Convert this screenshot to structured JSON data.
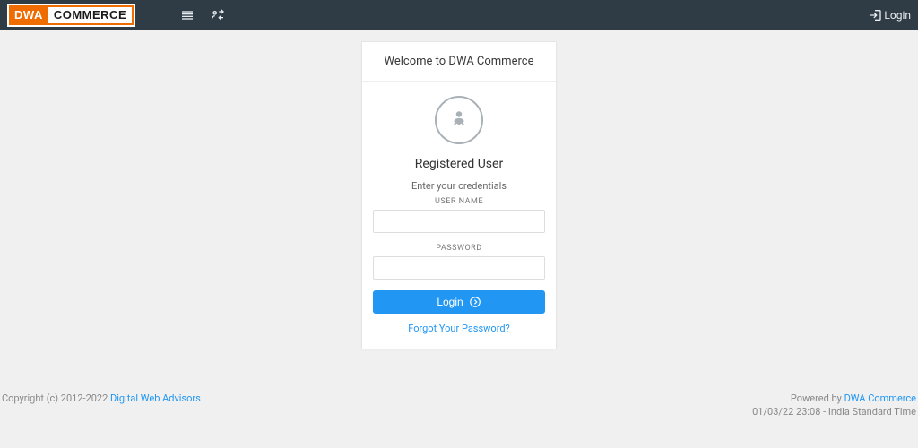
{
  "header": {
    "logo_part1": "DWA",
    "logo_part2": "COMMERCE",
    "login_label": "Login"
  },
  "card": {
    "welcome": "Welcome to DWA Commerce",
    "registered_title": "Registered User",
    "credentials_hint": "Enter your credentials",
    "username_label": "USER NAME",
    "password_label": "PASSWORD",
    "login_button": "Login",
    "forgot_link": "Forgot Your Password?"
  },
  "footer": {
    "copyright_prefix": "Copyright (c) 2012-2022 ",
    "copyright_link": "Digital Web Advisors",
    "powered_prefix": "Powered by ",
    "powered_link": "DWA Commerce",
    "timestamp": "01/03/22 23:08 - India Standard Time"
  }
}
